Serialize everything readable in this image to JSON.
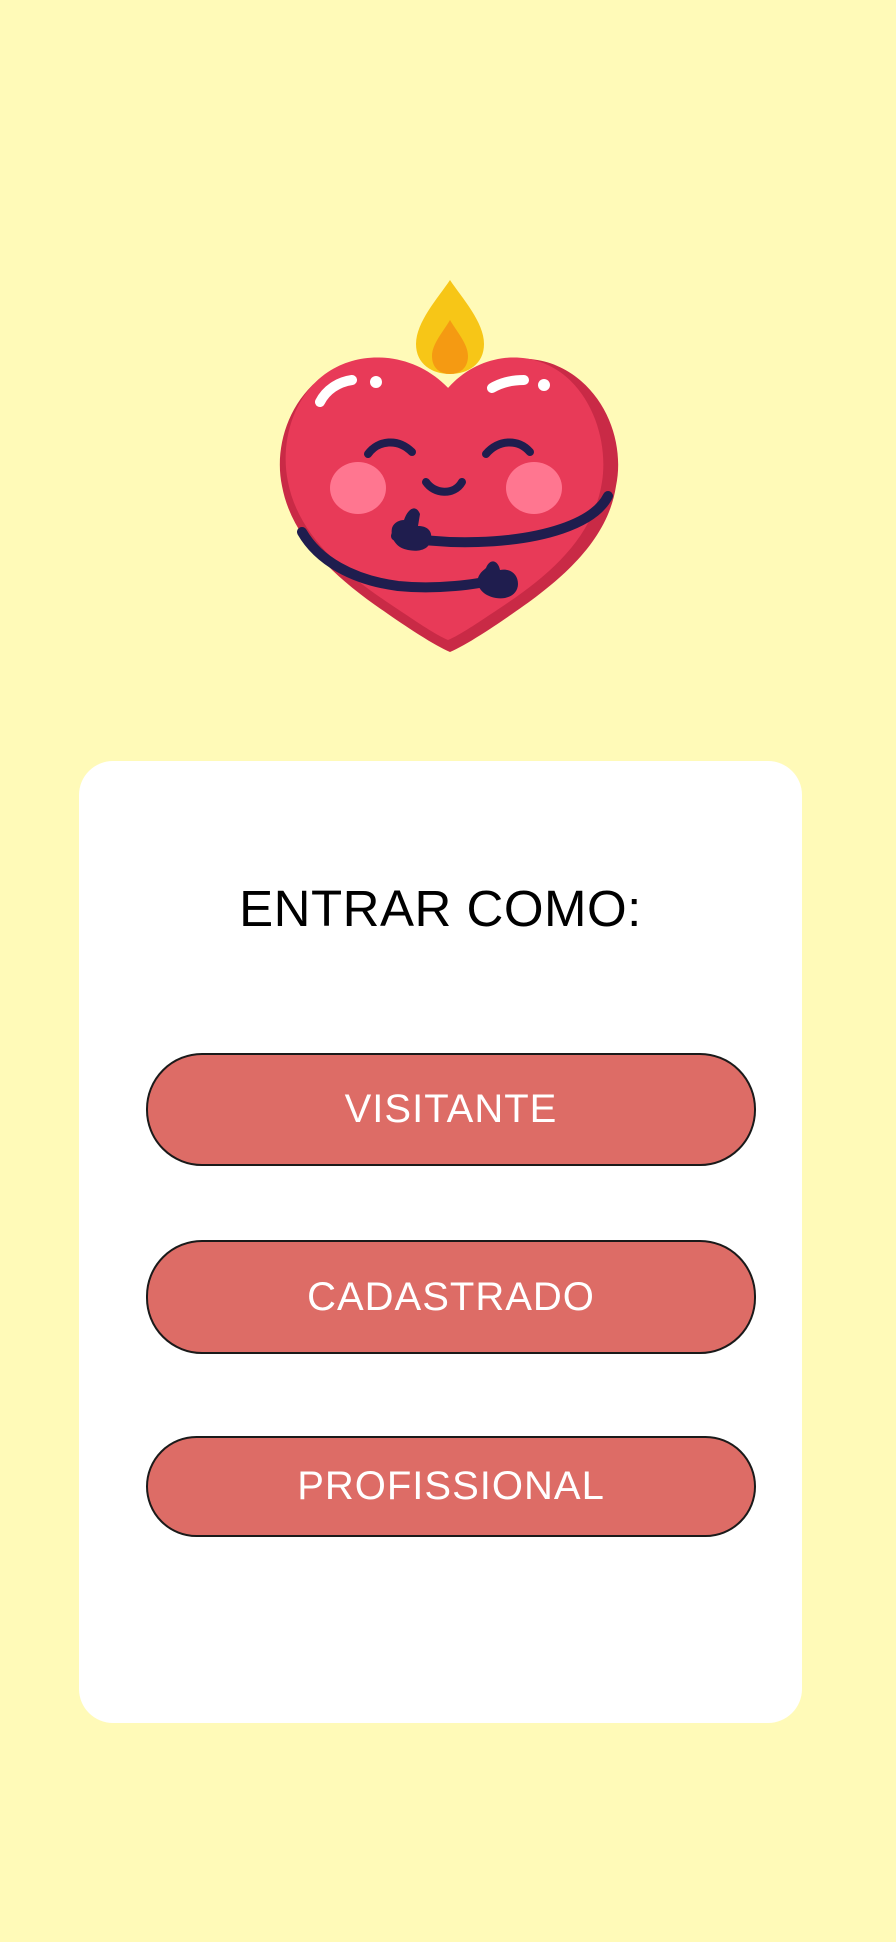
{
  "mascot": {
    "icon": "heart-candle-hugging-icon",
    "colors": {
      "heart": "#e83a58",
      "flame_outer": "#f7c617",
      "flame_inner": "#f59a12",
      "face": "#1f1d4e",
      "cheeks": "#ff7690"
    }
  },
  "card": {
    "title": "ENTRAR COMO:",
    "buttons": {
      "visitante": "VISITANTE",
      "cadastrado": "CADASTRADO",
      "profissional": "PROFISSIONAL"
    }
  },
  "colors": {
    "background": "#fffab8",
    "card": "#ffffff",
    "button": "#dd6c66",
    "button_border": "#1a1a1a",
    "button_text": "#ffffff"
  }
}
